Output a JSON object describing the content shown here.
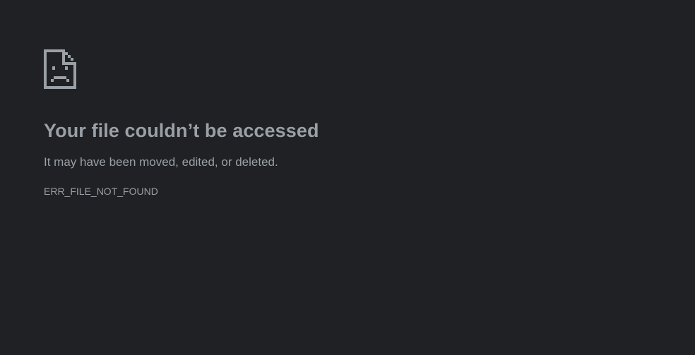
{
  "page": {
    "background_color": "#202124",
    "text_color": "#9aa0a6"
  },
  "error": {
    "icon": "sad-file-icon",
    "title": "Your file couldn’t be accessed",
    "message": "It may have been moved, edited, or deleted.",
    "code": "ERR_FILE_NOT_FOUND"
  }
}
